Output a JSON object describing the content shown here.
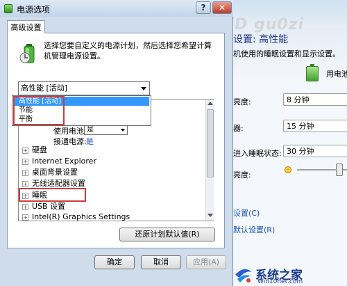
{
  "watermark": "百度ID gu0zi",
  "dialog": {
    "title": "电源选项",
    "help_label": "?",
    "close_label": "✕",
    "tab_label": "高级设置",
    "description": "选择您要自定义的电源计划，然后选择您希望计算机管理电源设置。",
    "plan_select_value": "高性能 [活动]",
    "plan_options": [
      "高性能 [活动]",
      "节能",
      "平衡"
    ],
    "sub_settings": {
      "battery_label": "使用电池:",
      "battery_value": "是",
      "plugged_label": "接通电源:",
      "plugged_value": "是"
    },
    "tree_items": [
      "硬盘",
      "Internet Explorer",
      "桌面背景设置",
      "无线适配器设置",
      "睡眠",
      "USB 设置",
      "Intel(R) Graphics Settings"
    ],
    "restore_button": "还原计划默认值(R)",
    "ok_button": "确定",
    "cancel_button": "取消",
    "apply_button": "应用(A)"
  },
  "background_window": {
    "title": "设置: 高性能",
    "subtitle": "机使用的睡眠设置和显示设置。",
    "battery_label": "用电池",
    "rows": [
      {
        "label": "亮度:",
        "value": "8 分钟"
      },
      {
        "label": "器:",
        "value": "15 分钟"
      },
      {
        "label": "进入睡眠状态:",
        "value": "30 分钟"
      }
    ],
    "brightness_label": "亮度:",
    "brightness_level_fraction": 0.85,
    "links": [
      "设置(C)",
      "默认设置(R)"
    ]
  },
  "logo": {
    "name": "系统之家",
    "url": "Win10net.com"
  },
  "colors": {
    "dialog_bg": "#cfdceb",
    "selected_highlight": "#3399ff",
    "annotation_red": "#d23a3a",
    "link_blue": "#1a55c2",
    "close_red": "#c03a24"
  },
  "icons": [
    "power-plan-icon",
    "battery-icon",
    "help-icon",
    "close-icon",
    "brightness-icon",
    "logo-icon"
  ]
}
